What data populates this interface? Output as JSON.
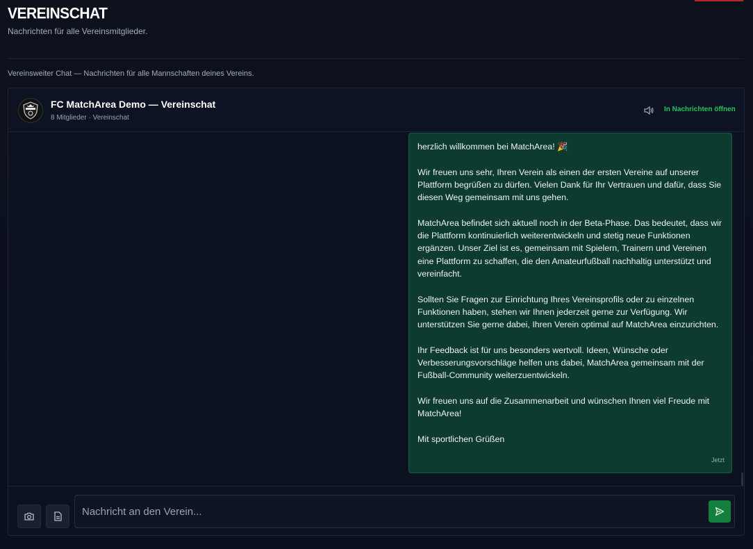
{
  "header": {
    "title": "VEREINSCHAT",
    "subtitle": "Nachrichten für alle Vereinsmitglieder."
  },
  "section_note": "Vereinsweiter Chat — Nachrichten für alle Mannschaften deines Vereins.",
  "chat": {
    "title": "FC MatchArea Demo — Vereinschat",
    "meta": "8 Mitglieder · Vereinschat",
    "open_link": "In Nachrichten öffnen",
    "avatar_icon": "club-crest-icon",
    "speaker_icon": "speaker-icon"
  },
  "message": {
    "paragraphs": [
      "herzlich willkommen bei MatchArea! 🎉",
      "Wir freuen uns sehr, Ihren Verein als einen der ersten Vereine auf unserer Plattform begrüßen zu dürfen. Vielen Dank für Ihr Vertrauen und dafür, dass Sie diesen Weg gemeinsam mit uns gehen.",
      "MatchArea befindet sich aktuell noch in der Beta-Phase. Das bedeutet, dass wir die Plattform kontinuierlich weiterentwickeln und stetig neue Funktionen ergänzen. Unser Ziel ist es, gemeinsam mit Spielern, Trainern und Vereinen eine Plattform zu schaffen, die den Amateurfußball nachhaltig unterstützt und vereinfacht.",
      "Sollten Sie Fragen zur Einrichtung Ihres Vereinsprofils oder zu einzelnen Funktionen haben, stehen wir Ihnen jederzeit gerne zur Verfügung. Wir unterstützen Sie gerne dabei, Ihren Verein optimal auf MatchArea einzurichten.",
      "Ihr Feedback ist für uns besonders wertvoll. Ideen, Wünsche oder Verbesserungsvorschläge helfen uns dabei, MatchArea gemeinsam mit der Fußball-Community weiterzuentwickeln.",
      "Wir freuen uns auf die Zusammenarbeit und wünschen Ihnen viel Freude mit MatchArea!",
      "Mit sportlichen Grüßen"
    ],
    "time": "Jetzt"
  },
  "composer": {
    "placeholder": "Nachricht an den Verein...",
    "value": "",
    "camera_icon": "camera-icon",
    "file_icon": "file-icon",
    "send_icon": "send-icon"
  },
  "colors": {
    "accent": "#22c55e",
    "bubble": "#0d3b2f",
    "send": "#15803d",
    "top_accent": "#b3262c"
  }
}
